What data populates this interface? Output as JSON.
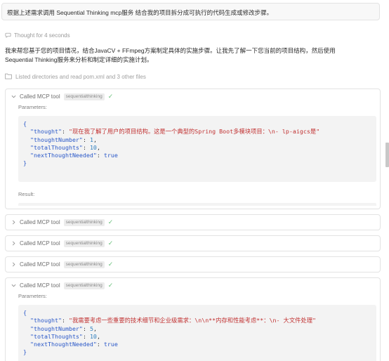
{
  "user_message": "根据上述需求调用 Sequential Thinking mcp服务 结合我的项目拆分成可执行的代码生成或修改步骤。",
  "thought": {
    "label": "Thought for 4 seconds",
    "icon": "thought-bubble-icon"
  },
  "answer_lines": [
    "我来帮您基于您的项目情况，结合JavaCV + FFmpeg方案制定具体的实施步骤。让我先了解一下您当前的项目结构，然后使用",
    "Sequential Thinking服务来分析和制定详细的实施计划。"
  ],
  "listed": {
    "label": "Listed directories and read pom.xml and 3 other files",
    "icon": "folder-icon"
  },
  "cards": [
    {
      "title": "Called MCP tool",
      "tool": "sequentialthinking",
      "expanded": true,
      "parameters_label": "Parameters:",
      "params": {
        "thought": "现在我了解了用户的项目结构。这是一个典型的Spring Boot多模块项目：\\n- lp-aigcs是",
        "thoughtNumber": "1",
        "totalThoughts": "10",
        "nextThoughtNeeded": "true"
      },
      "result_label": "Result:"
    },
    {
      "title": "Called MCP tool",
      "tool": "sequentialthinking",
      "expanded": false
    },
    {
      "title": "Called MCP tool",
      "tool": "sequentialthinking",
      "expanded": false
    },
    {
      "title": "Called MCP tool",
      "tool": "sequentialthinking",
      "expanded": false
    },
    {
      "title": "Called MCP tool",
      "tool": "sequentialthinking",
      "expanded": true,
      "parameters_label": "Parameters:",
      "params": {
        "thought": "我需要考虑一些重要的技术细节和企业级需求：\\n\\n**内存和性能考虑**：\\n- 大文件处理",
        "thoughtNumber": "5",
        "totalThoughts": "10",
        "nextThoughtNeeded": "true"
      }
    }
  ],
  "colors": {
    "check": "#68c07a",
    "key": "#2a58c8",
    "string": "#c13232",
    "number": "#2f7fbf",
    "code_bg": "#f3f3f3"
  }
}
